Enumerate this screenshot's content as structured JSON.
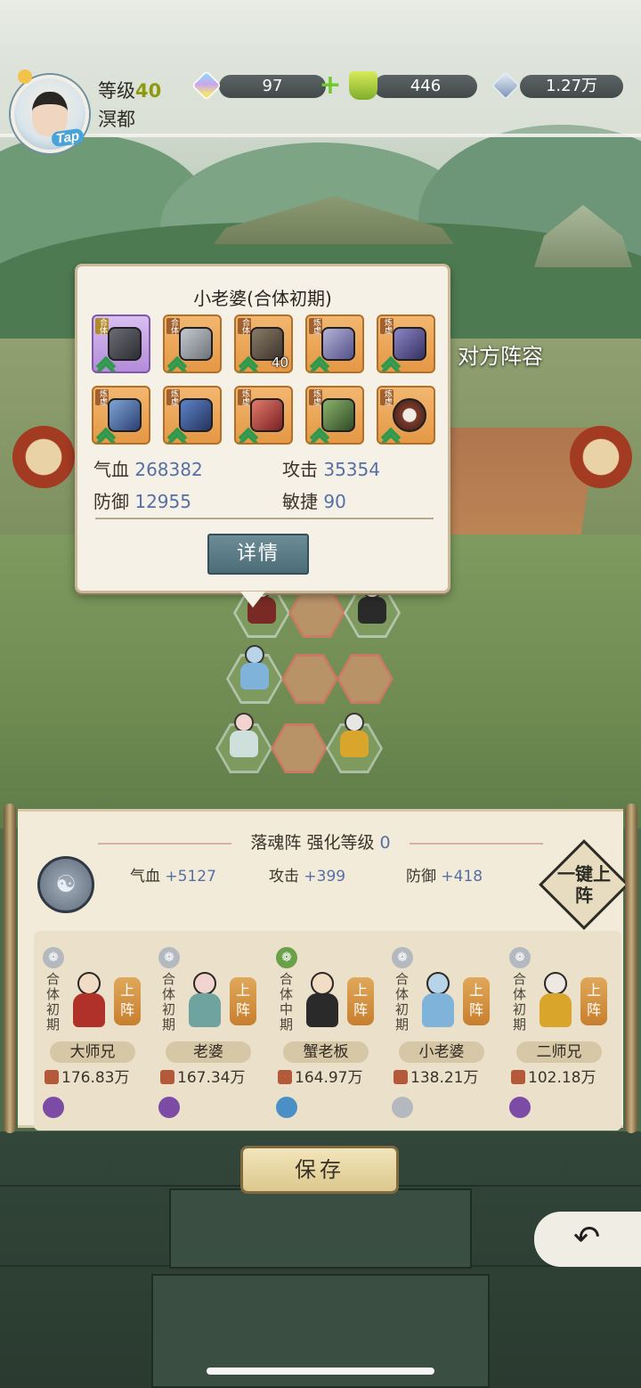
{
  "header": {
    "level_label": "等级",
    "level_value": "40",
    "server_name": "溟都",
    "avatar_tag": "Tap",
    "resources": [
      {
        "icon": "spirit-gem-icon",
        "value": "97"
      },
      {
        "icon": "jade-token-icon",
        "value": "446"
      },
      {
        "icon": "crystal-icon",
        "value": "1.27万"
      }
    ],
    "add_label": "+"
  },
  "popup": {
    "title": "小老婆(合体初期)",
    "equipment": [
      {
        "slot": "helmet",
        "badge": "合体",
        "rarity": "purple",
        "count": ""
      },
      {
        "slot": "tome",
        "badge": "合体",
        "rarity": "orange",
        "count": ""
      },
      {
        "slot": "beast",
        "badge": "合体",
        "rarity": "orange",
        "count": "40"
      },
      {
        "slot": "robe",
        "badge": "炼虚",
        "rarity": "orange",
        "count": ""
      },
      {
        "slot": "boots",
        "badge": "炼虚",
        "rarity": "orange",
        "count": ""
      },
      {
        "slot": "staff",
        "badge": "炼虚",
        "rarity": "orange",
        "count": ""
      },
      {
        "slot": "necklace",
        "badge": "炼虚",
        "rarity": "orange",
        "count": ""
      },
      {
        "slot": "gauntlet",
        "badge": "炼虚",
        "rarity": "orange",
        "count": ""
      },
      {
        "slot": "belt",
        "badge": "炼虚",
        "rarity": "orange",
        "count": ""
      },
      {
        "slot": "ring",
        "badge": "炼虚",
        "rarity": "orange",
        "count": ""
      }
    ],
    "stats": {
      "hp_label": "气血",
      "hp_value": "268382",
      "atk_label": "攻击",
      "atk_value": "35354",
      "def_label": "防御",
      "def_value": "12955",
      "agi_label": "敏捷",
      "agi_value": "90"
    },
    "detail_button": "详情"
  },
  "battlefield": {
    "enemy_lineup_label": "对方阵容"
  },
  "formation_panel": {
    "title": "落魂阵 强化等级",
    "title_level": "0",
    "bonuses": [
      {
        "label": "气血",
        "value": "+5127"
      },
      {
        "label": "攻击",
        "value": "+399"
      },
      {
        "label": "防御",
        "value": "+418"
      }
    ],
    "one_click_label": "一键上阵",
    "heroes": [
      {
        "realm": "合体初期",
        "name": "大师兄",
        "power": "176.83万",
        "deploy": "上阵",
        "color": "#b0302a"
      },
      {
        "realm": "合体初期",
        "name": "老婆",
        "power": "167.34万",
        "deploy": "上阵",
        "color": "#6fa3a0"
      },
      {
        "realm": "合体中期",
        "name": "蟹老板",
        "power": "164.97万",
        "deploy": "上阵",
        "color": "#2a2a2a"
      },
      {
        "realm": "合体初期",
        "name": "小老婆",
        "power": "138.21万",
        "deploy": "上阵",
        "color": "#7fb3da"
      },
      {
        "realm": "合体初期",
        "name": "二师兄",
        "power": "102.18万",
        "deploy": "上阵",
        "color": "#d9a52a"
      }
    ]
  },
  "footer": {
    "save_button": "保存",
    "back_glyph": "↶"
  }
}
